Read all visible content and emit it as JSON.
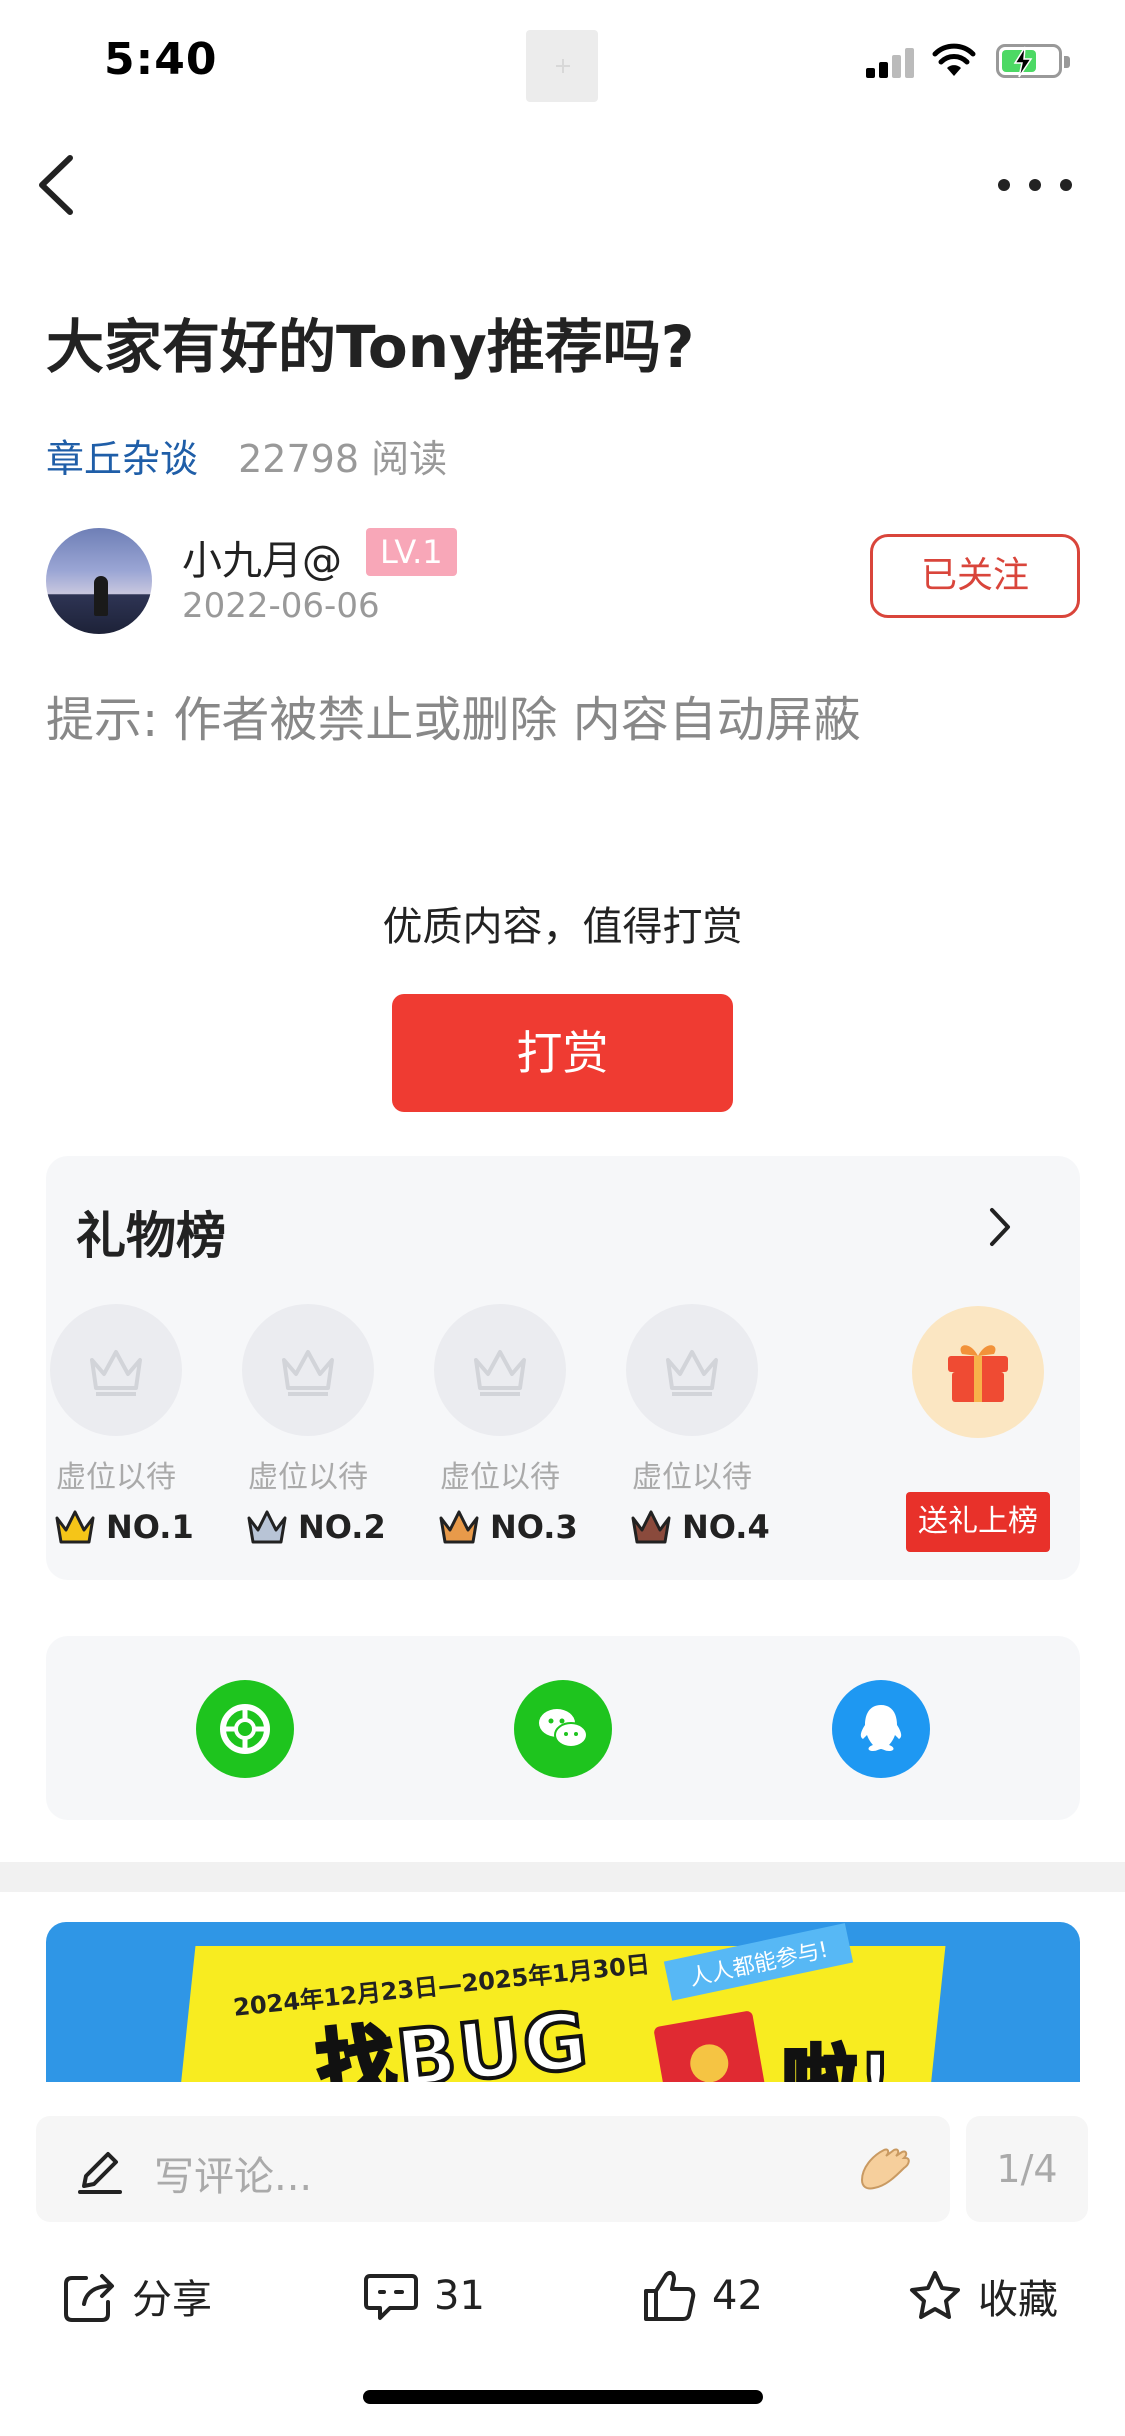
{
  "status_bar": {
    "time": "5:40"
  },
  "post": {
    "title": "大家有好的Tony推荐吗?",
    "category": "章丘杂谈",
    "reads": "22798 阅读",
    "notice": "提示: 作者被禁止或删除 内容自动屏蔽"
  },
  "author": {
    "name": "小九月@",
    "level": "LV.1",
    "date": "2022-06-06",
    "follow_label": "已关注"
  },
  "reward": {
    "hint": "优质内容，值得打赏",
    "button_label": "打赏"
  },
  "gift_board": {
    "title": "礼物榜",
    "slots": [
      {
        "label": "虚位以待",
        "rank": "NO.1",
        "crown_color": "#f5c518"
      },
      {
        "label": "虚位以待",
        "rank": "NO.2",
        "crown_color": "#b8c4d6"
      },
      {
        "label": "虚位以待",
        "rank": "NO.3",
        "crown_color": "#e89a4a"
      },
      {
        "label": "虚位以待",
        "rank": "NO.4",
        "crown_color": "#8a4a3c"
      }
    ],
    "send_label": "送礼上榜"
  },
  "share_targets": [
    {
      "name": "moments-icon",
      "color": "#1ec41e"
    },
    {
      "name": "wechat-icon",
      "color": "#1ec41e"
    },
    {
      "name": "qq-icon",
      "color": "#1e98f2"
    }
  ],
  "banner": {
    "dates": "2024年12月23日—2025年1月30日",
    "headline": "找BUG",
    "tag": "人人都能参与!",
    "suffix": "啦!"
  },
  "comment_bar": {
    "placeholder": "写评论...",
    "page_indicator": "1/4"
  },
  "actions": {
    "share_label": "分享",
    "comments_count": "31",
    "likes_count": "42",
    "favorite_label": "收藏"
  },
  "colors": {
    "accent": "#ef3b32",
    "link": "#1f5ea8",
    "panel": "#f6f7f9"
  }
}
